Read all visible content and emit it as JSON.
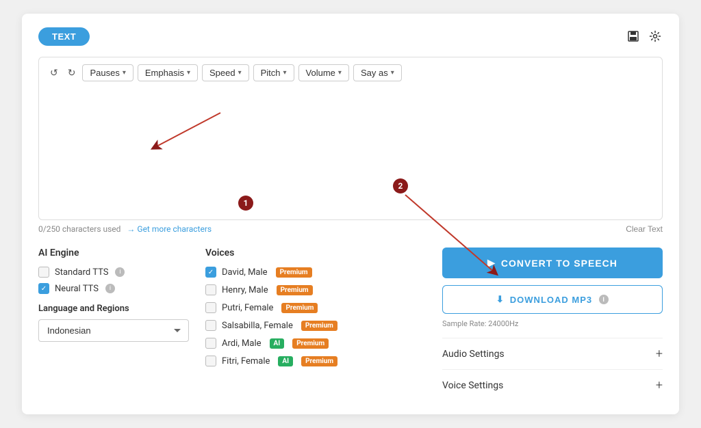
{
  "header": {
    "text_button": "TEXT",
    "save_icon": "💾",
    "gear_icon": "⚙"
  },
  "toolbar": {
    "undo_label": "↺",
    "redo_label": "↻",
    "pauses_label": "Pauses",
    "emphasis_label": "Emphasis",
    "speed_label": "Speed",
    "pitch_label": "Pitch",
    "volume_label": "Volume",
    "say_as_label": "Say as"
  },
  "editor": {
    "placeholder": "",
    "char_count": "0/250 characters used",
    "get_more_label": "→ Get more characters",
    "clear_text_label": "Clear Text"
  },
  "ai_engine": {
    "title": "AI Engine",
    "standard_tts_label": "Standard TTS",
    "neural_tts_label": "Neural TTS",
    "standard_checked": false,
    "neural_checked": true,
    "language_region_title": "Language and Regions",
    "language_value": "Indonesian"
  },
  "voices": {
    "title": "Voices",
    "items": [
      {
        "label": "David, Male",
        "checked": true,
        "badges": [
          "Premium"
        ]
      },
      {
        "label": "Henry, Male",
        "checked": false,
        "badges": [
          "Premium"
        ]
      },
      {
        "label": "Putri, Female",
        "checked": false,
        "badges": [
          "Premium"
        ]
      },
      {
        "label": "Salsabilla, Female",
        "checked": false,
        "badges": [
          "Premium"
        ]
      },
      {
        "label": "Ardi, Male",
        "checked": false,
        "badges": [
          "AI",
          "Premium"
        ]
      },
      {
        "label": "Fitri, Female",
        "checked": false,
        "badges": [
          "AI",
          "Premium"
        ]
      }
    ]
  },
  "actions": {
    "convert_label": "CONVERT TO SPEECH",
    "download_label": "DOWNLOAD MP3",
    "sample_rate": "Sample Rate: 24000Hz",
    "audio_settings_label": "Audio Settings",
    "voice_settings_label": "Voice Settings"
  }
}
